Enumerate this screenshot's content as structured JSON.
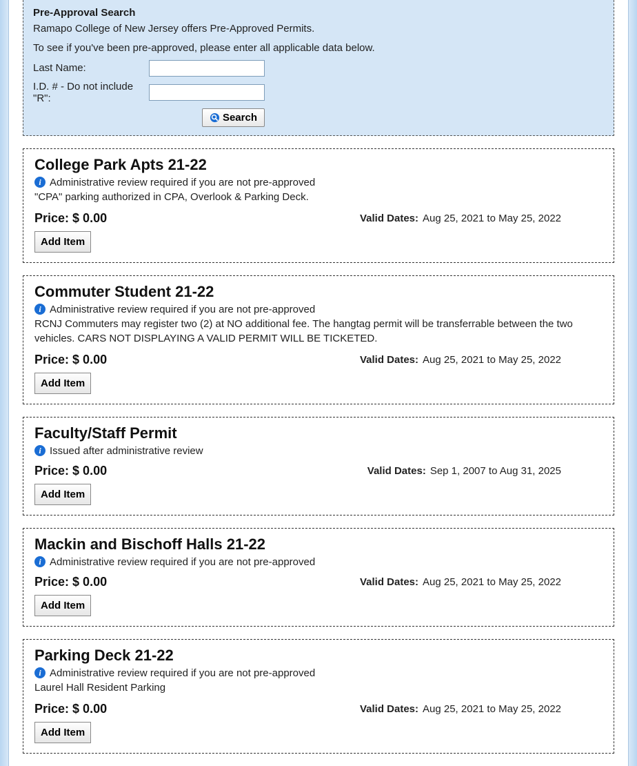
{
  "search": {
    "title": "Pre-Approval Search",
    "line1": "Ramapo College of New Jersey offers Pre-Approved Permits.",
    "line2": "To see if you've been pre-approved, please enter all applicable data below.",
    "label_lastname": "Last Name:",
    "label_id": "I.D. # - Do not include \"R\":",
    "btn": "Search"
  },
  "labels": {
    "price": "Price:",
    "valid_dates": "Valid Dates:",
    "add_item": "Add Item"
  },
  "permits": [
    {
      "title": "College Park Apts 21-22",
      "info": "Administrative review required if you are not pre-approved",
      "desc": "\"CPA\" parking authorized in CPA, Overlook & Parking Deck.",
      "price": "$ 0.00",
      "valid": "Aug 25, 2021 to May 25, 2022"
    },
    {
      "title": "Commuter Student 21-22",
      "info": "Administrative review required if you are not pre-approved",
      "desc": "RCNJ Commuters may register two (2) at NO additional fee. The hangtag permit will be transferrable between the two vehicles. CARS NOT DISPLAYING A VALID PERMIT WILL BE TICKETED.",
      "price": "$ 0.00",
      "valid": "Aug 25, 2021 to May 25, 2022"
    },
    {
      "title": "Faculty/Staff Permit",
      "info": "Issued after administrative review",
      "desc": "",
      "price": "$ 0.00",
      "valid": "Sep 1, 2007 to Aug 31, 2025"
    },
    {
      "title": "Mackin and Bischoff Halls 21-22",
      "info": "Administrative review required if you are not pre-approved",
      "desc": "",
      "price": "$ 0.00",
      "valid": "Aug 25, 2021 to May 25, 2022"
    },
    {
      "title": "Parking Deck 21-22",
      "info": "Administrative review required if you are not pre-approved",
      "desc": "Laurel Hall Resident Parking",
      "price": "$ 0.00",
      "valid": "Aug 25, 2021 to May 25, 2022"
    }
  ]
}
